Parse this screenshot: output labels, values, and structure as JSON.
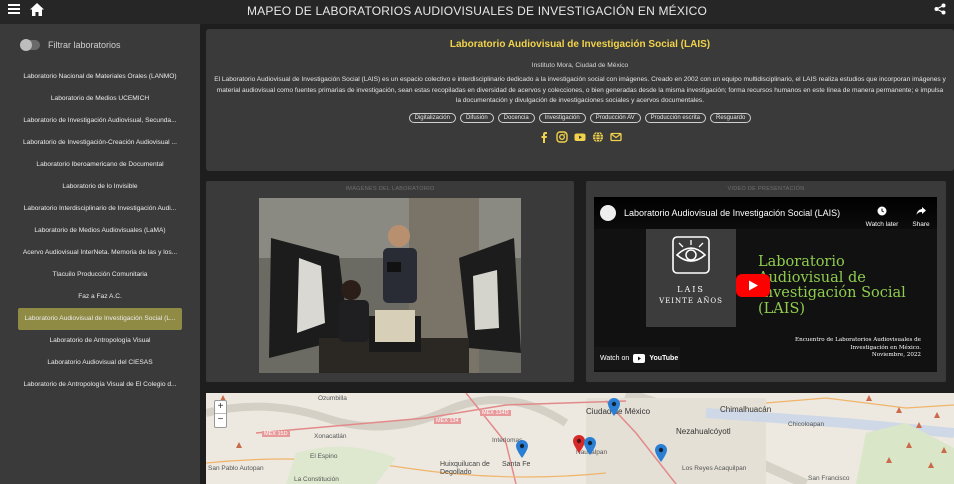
{
  "header": {
    "title": "MAPEO DE LABORATORIOS AUDIOVISUALES DE INVESTIGACIÓN EN MÉXICO",
    "menu_icon": "hamburger-menu-icon",
    "home_icon": "home-icon",
    "share_icon": "share-icon"
  },
  "sidebar": {
    "filter_label": "Filtrar laboratorios",
    "filter_on": false,
    "items": [
      {
        "label": "Laboratorio Nacional de Materiales Orales (LANMO)"
      },
      {
        "label": "Laboratorio de Medios UCEMICH"
      },
      {
        "label": "Laboratorio de Investigación Audiovisual, Secunda..."
      },
      {
        "label": "Laboratorio de Investigación-Creación Audiovisual ..."
      },
      {
        "label": "Laboratorio Iberoamericano de Documental"
      },
      {
        "label": "Laboratorio de lo Invisible"
      },
      {
        "label": "Laboratorio Interdisciplinario de Investigación Audi..."
      },
      {
        "label": "Laboratorio de Medios Audiovisuales (LaMA)"
      },
      {
        "label": "Acervo Audiovisual InterNeta. Memoria de las y los..."
      },
      {
        "label": "Tlacuilo Producción Comunitaria"
      },
      {
        "label": "Faz a Faz A.C."
      },
      {
        "label": "Laboratorio Audiovisual de Investigación Social (L..."
      },
      {
        "label": "Laboratorio de Antropología Visual"
      },
      {
        "label": "Laboratorio Audiovisual del CIESAS"
      },
      {
        "label": "Laboratorio de Antropología Visual de El Colegio d..."
      }
    ],
    "active_index": 11
  },
  "info": {
    "title": "Laboratorio Audiovisual de Investigación Social (LAIS)",
    "location": "Instituto Mora, Ciudad de México",
    "description": "El Laboratorio Audiovisual de Investigación Social (LAIS) es un espacio colectivo e interdisciplinario dedicado a la investigación social con imágenes. Creado en 2002 con un equipo multidisciplinario, el LAIS realiza estudios que incorporan imágenes y material audiovisual como fuentes primarias de investigación, sean estas recopiladas en diversidad de acervos y colecciones, o bien generadas desde la misma investigación; forma recursos humanos en este línea de manera permanente; e impulsa la documentación y divulgación de investigaciones sociales y acervos documentales.",
    "tags": [
      "Digitalización",
      "Difusión",
      "Docencia",
      "Investigación",
      "Producción AV",
      "Producción escrita",
      "Resguardo"
    ],
    "socials": [
      "facebook-icon",
      "instagram-icon",
      "youtube-icon",
      "web-globe-icon",
      "email-icon"
    ],
    "accent_color": "#f1d34b"
  },
  "images_panel": {
    "caption": "IMÁGENES DEL LABORATORIO"
  },
  "video_panel": {
    "caption": "VIDEO DE PRESENTACIÓN",
    "video_title": "Laboratorio Audiovisual de Investigación Social (LAIS)",
    "watch_later": "Watch later",
    "share": "Share",
    "logo_text": "LAIS",
    "logo_sub": "VEINTE AÑOS",
    "big_title_lines": [
      "Laboratorio",
      "Audiovisual de",
      "Investigación Social",
      "(LAIS)"
    ],
    "subtitle_lines": [
      "Encuentro de Laboratorios Audiovisuales de",
      "Investigación en México.",
      "Noviembre, 2022"
    ],
    "watch_on": "Watch on",
    "youtube_label": "YouTube"
  },
  "map": {
    "zoom_in": "+",
    "zoom_out": "−",
    "labels": [
      "Ciudad de México",
      "Chimalhuacán",
      "Nezahualcóyotl",
      "Interlomas",
      "Huixquilucan de Degollado",
      "Santa Fe",
      "Naucalpan",
      "El Espino",
      "Xonacatlán",
      "San Pablo Autopan",
      "La Constitución",
      "Los Reyes Acaquilpan",
      "San Francisco",
      "Chicoloapan",
      "MEX 134D",
      "MEX 134",
      "MEX 15D",
      "Ozumbilla"
    ]
  }
}
